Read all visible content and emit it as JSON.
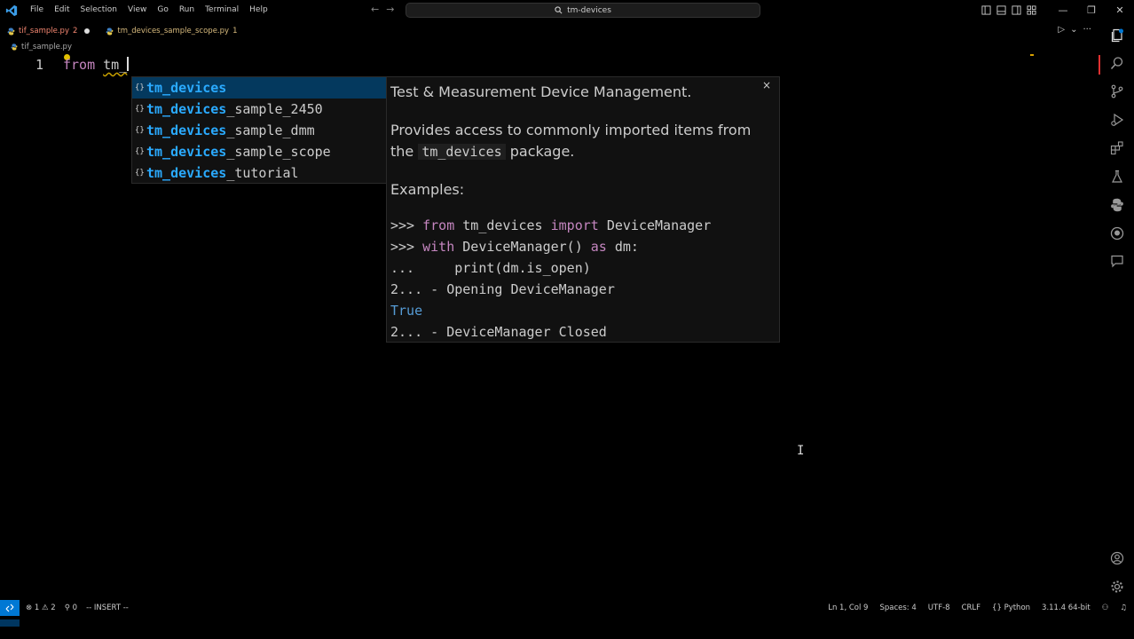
{
  "menu": [
    "File",
    "Edit",
    "Selection",
    "View",
    "Go",
    "Run",
    "Terminal",
    "Help"
  ],
  "search": {
    "label": "tm-devices"
  },
  "window": {
    "minimize": "—",
    "restore": "❐",
    "close": "✕"
  },
  "tabs": [
    {
      "label": "tif_sample.py",
      "count": "2"
    },
    {
      "label": "tm_devices_sample_scope.py",
      "count": "1"
    }
  ],
  "breadcrumb": "tif_sample.py",
  "editor": {
    "line_number": "1",
    "keyword": "from",
    "typed": "tm_"
  },
  "suggestions": [
    {
      "match": "tm_devices",
      "rest": ""
    },
    {
      "match": "tm_devices",
      "rest": "_sample_2450"
    },
    {
      "match": "tm_devices",
      "rest": "_sample_dmm"
    },
    {
      "match": "tm_devices",
      "rest": "_sample_scope"
    },
    {
      "match": "tm_devices",
      "rest": "_tutorial"
    }
  ],
  "suggest_icon": "{}",
  "details": {
    "title": "Test & Measurement Device Management.",
    "desc_1": "Provides access to commonly imported items from",
    "desc_2a": "the ",
    "desc_code": "tm_devices",
    "desc_2b": " package.",
    "examples_label": "Examples:",
    "ex1_prompt": ">>> ",
    "ex1_kw": "from",
    "ex1_mid": " tm_devices ",
    "ex1_kw2": "import",
    "ex1_end": " DeviceManager",
    "ex2_prompt": ">>> ",
    "ex2_kw": "with",
    "ex2_mid": " DeviceManager() ",
    "ex2_kw2": "as",
    "ex2_end": " dm:",
    "ex3": "...     print(dm.is_open)",
    "ex4": "2... - Opening DeviceManager",
    "ex5": "True",
    "ex6": "2... - DeviceManager Closed",
    "close": "×"
  },
  "status": {
    "errors": "1",
    "warnings": "2",
    "ports": "0",
    "mode": "-- INSERT --",
    "position": "Ln 1, Col 9",
    "spaces": "Spaces: 4",
    "encoding": "UTF-8",
    "eol": "CRLF",
    "language": "Python",
    "interpreter": "3.11.4 64-bit"
  },
  "colors": {
    "accent": "#0078d4",
    "selection": "#04395e",
    "keyword": "#c586c0",
    "error": "#f48771"
  }
}
